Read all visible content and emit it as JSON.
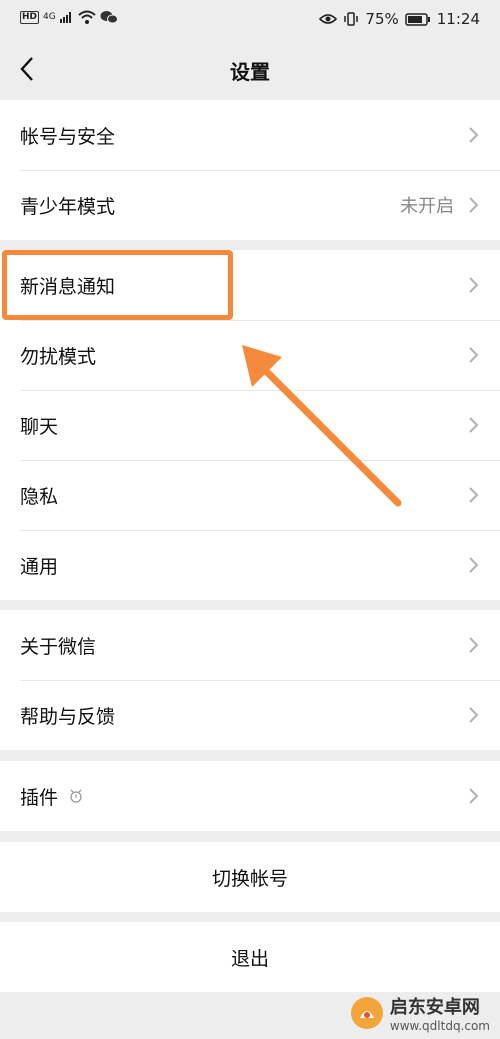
{
  "status_bar": {
    "hd": "HD",
    "signal_type": "4G",
    "battery": "75%",
    "time": "11:24",
    "icons": [
      "hd-icon",
      "signal-icon",
      "wifi-icon",
      "wechat-icon",
      "eye-icon",
      "vibrate-icon",
      "battery-icon"
    ]
  },
  "nav": {
    "title": "设置",
    "back_icon": "chevron-left-icon"
  },
  "group1": [
    {
      "label": "帐号与安全"
    },
    {
      "label": "青少年模式",
      "value": "未开启"
    }
  ],
  "group2": [
    {
      "label": "新消息通知"
    },
    {
      "label": "勿扰模式"
    },
    {
      "label": "聊天"
    },
    {
      "label": "隐私"
    },
    {
      "label": "通用"
    }
  ],
  "group3": [
    {
      "label": "关于微信"
    },
    {
      "label": "帮助与反馈"
    }
  ],
  "group4": [
    {
      "label": "插件",
      "icon": "plugin-icon"
    }
  ],
  "actions": {
    "switch_account": "切换帐号",
    "logout": "退出"
  },
  "annotation": {
    "color": "#f58a3c"
  },
  "watermark": {
    "name": "启东安卓网",
    "url": "www.qdltdq.com"
  }
}
